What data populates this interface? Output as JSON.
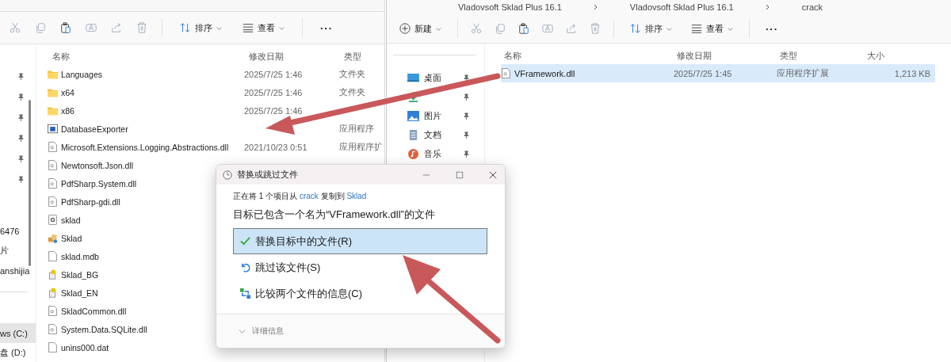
{
  "left_window": {
    "toolbar": {
      "sort": "排序",
      "view": "查看",
      "more": "···"
    },
    "nav": {
      "items": [
        {
          "pinned": true,
          "selected": false
        },
        {
          "pinned": true,
          "selected": false
        },
        {
          "pinned": true,
          "selected": false
        },
        {
          "pinned": true,
          "selected": false
        },
        {
          "pinned": true,
          "selected": false
        },
        {
          "pinned": true,
          "selected": false
        },
        {
          "label": "6476",
          "pinned": false,
          "selected": false
        },
        {
          "label": "片",
          "pinned": false,
          "selected": false
        },
        {
          "label": "anshijia",
          "pinned": false,
          "selected": false
        },
        {
          "label": "ws (C:)",
          "pinned": false,
          "selected": true
        },
        {
          "label": "盘 (D:)",
          "pinned": false,
          "selected": false
        }
      ]
    },
    "columns": [
      "名称",
      "修改日期",
      "类型"
    ],
    "rows": [
      {
        "kind": "folder",
        "name": "Languages",
        "date": "2025/7/25 1:46",
        "type": "文件夹"
      },
      {
        "kind": "folder",
        "name": "x64",
        "date": "2025/7/25 1:46",
        "type": "文件夹"
      },
      {
        "kind": "folder",
        "name": "x86",
        "date": "2025/7/25 1:46"
      },
      {
        "kind": "app",
        "name": "DatabaseExporter",
        "type": "应用程序"
      },
      {
        "kind": "dll",
        "name": "Microsoft.Extensions.Logging.Abstractions.dll",
        "date": "2021/10/23 0:51",
        "type": "应用程序扩"
      },
      {
        "kind": "dll",
        "name": "Newtonsoft.Json.dll"
      },
      {
        "kind": "dll",
        "name": "PdfSharp.System.dll"
      },
      {
        "kind": "dll",
        "name": "PdfSharp-gdi.dll"
      },
      {
        "kind": "settings",
        "name": "sklad"
      },
      {
        "kind": "package",
        "name": "Sklad"
      },
      {
        "kind": "file",
        "name": "sklad.mdb"
      },
      {
        "kind": "help",
        "name": "Sklad_BG"
      },
      {
        "kind": "help",
        "name": "Sklad_EN"
      },
      {
        "kind": "dll",
        "name": "SkladCommon.dll"
      },
      {
        "kind": "dll",
        "name": "System.Data.SQLite.dll"
      },
      {
        "kind": "file",
        "name": "unins000.dat"
      }
    ]
  },
  "right_window": {
    "breadcrumbs": [
      "Vladovsoft Sklad Plus 16.1",
      "Vladovsoft Sklad Plus 16.1",
      "crack"
    ],
    "toolbar": {
      "new": "新建",
      "sort": "排序",
      "view": "查看",
      "more": "···"
    },
    "nav": {
      "items": [
        {
          "kind": "desktop",
          "label": "桌面",
          "pinned": true
        },
        {
          "kind": "download",
          "pinned": true
        },
        {
          "kind": "pictures",
          "label": "图片",
          "pinned": true
        },
        {
          "kind": "documents",
          "label": "文档",
          "pinned": true
        },
        {
          "kind": "music",
          "label": "音乐",
          "pinned": true
        }
      ]
    },
    "columns": [
      "名称",
      "修改日期",
      "类型",
      "大小"
    ],
    "rows": [
      {
        "kind": "dll",
        "name": "VFramework.dll",
        "date": "2025/7/25 1:45",
        "type": "应用程序扩展",
        "size": "1,213 KB",
        "selected": true
      }
    ]
  },
  "dialog": {
    "title": "替换或跳过文件",
    "copy_parts": [
      {
        "kind": "text",
        "text": "正在将 1 个项目从 "
      },
      {
        "kind": "link",
        "text": "crack"
      },
      {
        "kind": "text",
        "text": " 复制到 "
      },
      {
        "kind": "link",
        "text": "Sklad"
      }
    ],
    "heading": "目标已包含一个名为“VFramework.dll”的文件",
    "options": [
      {
        "kind": "replace",
        "label": "替换目标中的文件(R)",
        "selected": true
      },
      {
        "kind": "skip",
        "label": "跳过该文件(S)",
        "selected": false
      },
      {
        "kind": "compare",
        "label": "比较两个文件的信息(C)",
        "selected": false
      }
    ],
    "details": "详细信息"
  }
}
